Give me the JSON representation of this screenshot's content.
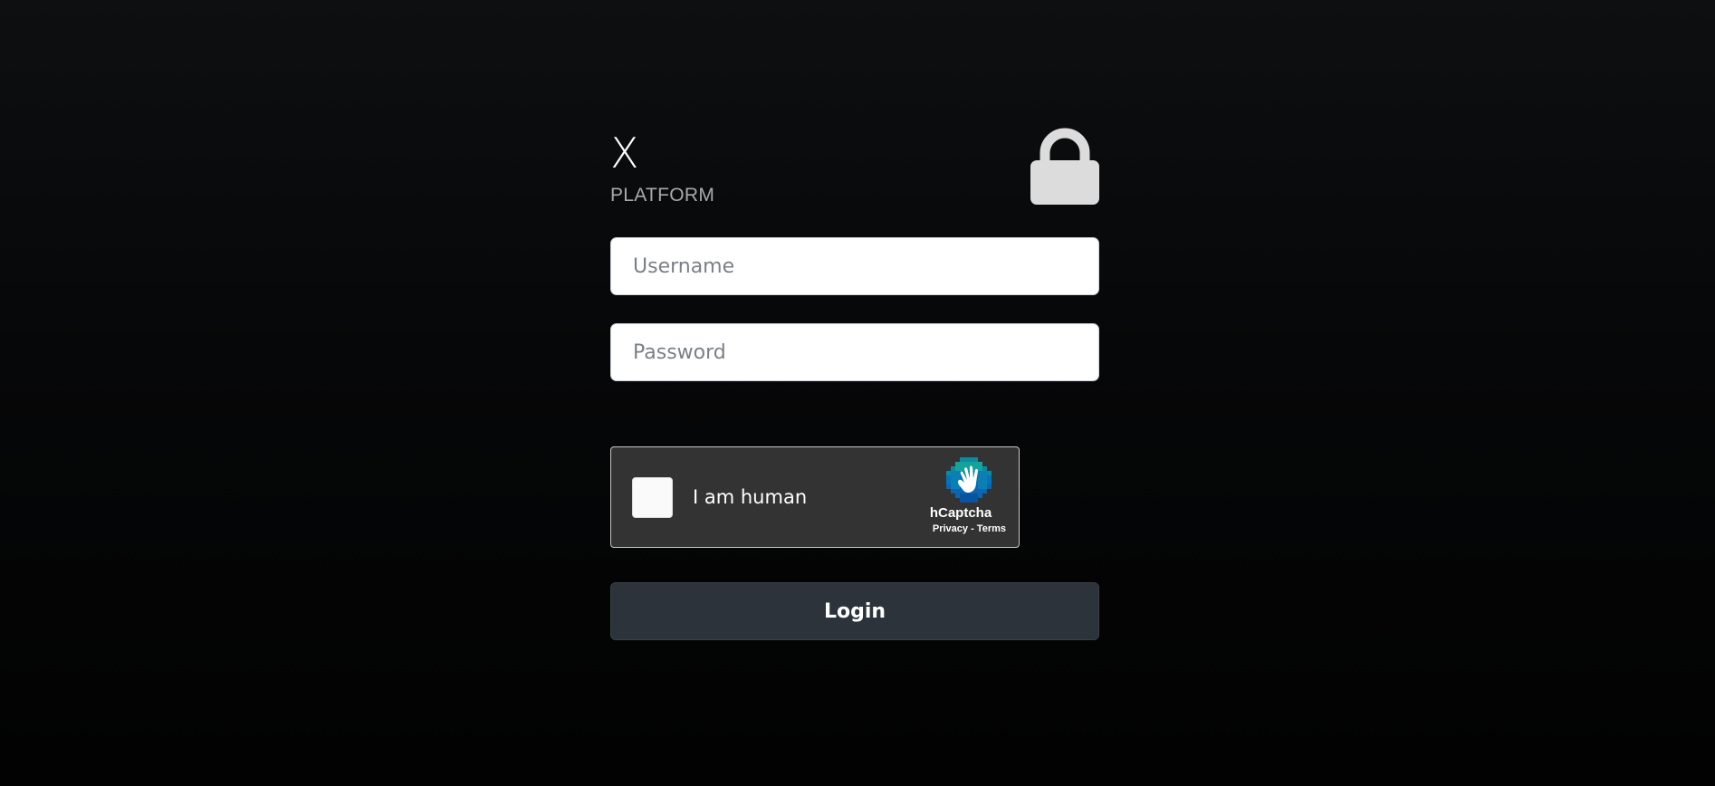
{
  "brand": {
    "title": "X",
    "subtitle": "PLATFORM"
  },
  "form": {
    "username_placeholder": "Username",
    "password_placeholder": "Password",
    "username_value": "",
    "password_value": ""
  },
  "captcha": {
    "label": "I am human",
    "brand": "hCaptcha",
    "privacy_label": "Privacy",
    "separator": " - ",
    "terms_label": "Terms"
  },
  "actions": {
    "login_label": "Login"
  },
  "icons": {
    "lock": "lock-icon",
    "captcha_logo": "hcaptcha-logo"
  },
  "colors": {
    "background": "#060708",
    "input_bg": "#ffffff",
    "captcha_bg": "#333333",
    "button_bg": "#2c333a",
    "lock": "#dcdcdc",
    "subtitle": "#a7a9ab"
  }
}
